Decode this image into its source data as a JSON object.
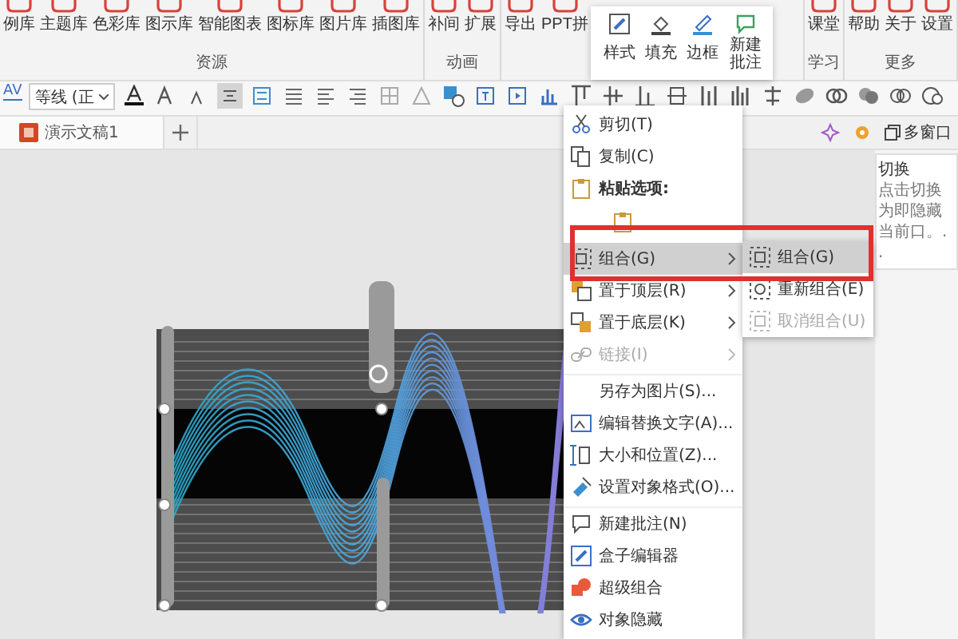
{
  "ribbon": {
    "groups": [
      {
        "label": "资源",
        "buttons": [
          "例库",
          "主题库",
          "色彩库",
          "图示库",
          "智能图表",
          "图标库",
          "图片库",
          "插图库"
        ]
      },
      {
        "label": "动画",
        "buttons": [
          "补间",
          "扩展"
        ]
      },
      {
        "buttons": [
          "导出",
          "PPT拼"
        ]
      },
      {
        "label": "学习",
        "buttons": [
          "课堂"
        ]
      },
      {
        "label": "更多",
        "buttons": [
          "帮助",
          "关于",
          "设置"
        ]
      }
    ]
  },
  "mini_toolbar": {
    "buttons": [
      "样式",
      "填充",
      "边框",
      "新建批注"
    ]
  },
  "format_toolbar": {
    "char_spacing": "AV",
    "font": "等线 (正"
  },
  "document_tabs": [
    {
      "label": "演示文稿1",
      "selected": true
    }
  ],
  "pane": {
    "button": "多窗口"
  },
  "tooltip": {
    "title": "切换",
    "text": "点击切换为即隐藏当前口。. ."
  },
  "context_menu": [
    {
      "kind": "item",
      "label": "剪切(T)",
      "disabled": false,
      "selected": false,
      "submenu": false
    },
    {
      "kind": "item",
      "label": "复制(C)",
      "disabled": false,
      "selected": false,
      "submenu": false
    },
    {
      "kind": "header",
      "label": "粘贴选项:"
    },
    {
      "kind": "paste"
    },
    {
      "kind": "item",
      "label": "组合(G)",
      "disabled": false,
      "selected": true,
      "submenu": true
    },
    {
      "kind": "item",
      "label": "置于顶层(R)",
      "disabled": false,
      "selected": false,
      "submenu": true
    },
    {
      "kind": "item",
      "label": "置于底层(K)",
      "disabled": false,
      "selected": false,
      "submenu": true
    },
    {
      "kind": "item",
      "label": "链接(I)",
      "disabled": true,
      "selected": false,
      "submenu": true
    },
    {
      "kind": "item",
      "label": "另存为图片(S)...",
      "disabled": false,
      "selected": false,
      "submenu": false
    },
    {
      "kind": "item",
      "label": "编辑替换文字(A)...",
      "disabled": false,
      "selected": false,
      "submenu": false
    },
    {
      "kind": "item",
      "label": "大小和位置(Z)...",
      "disabled": false,
      "selected": false,
      "submenu": false
    },
    {
      "kind": "item",
      "label": "设置对象格式(O)...",
      "disabled": false,
      "selected": false,
      "submenu": false
    },
    {
      "kind": "item",
      "label": "新建批注(N)",
      "disabled": false,
      "selected": false,
      "submenu": false
    },
    {
      "kind": "item",
      "label": "盒子编辑器",
      "disabled": false,
      "selected": false,
      "submenu": false
    },
    {
      "kind": "item",
      "label": "超级组合",
      "disabled": false,
      "selected": false,
      "submenu": false
    },
    {
      "kind": "item",
      "label": "对象隐藏",
      "disabled": false,
      "selected": false,
      "submenu": false
    }
  ],
  "submenu": [
    {
      "label": "组合(G)",
      "selected": true,
      "disabled": false
    },
    {
      "label": "重新组合(E)",
      "selected": false,
      "disabled": false
    },
    {
      "label": "取消组合(U)",
      "selected": false,
      "disabled": true
    }
  ]
}
